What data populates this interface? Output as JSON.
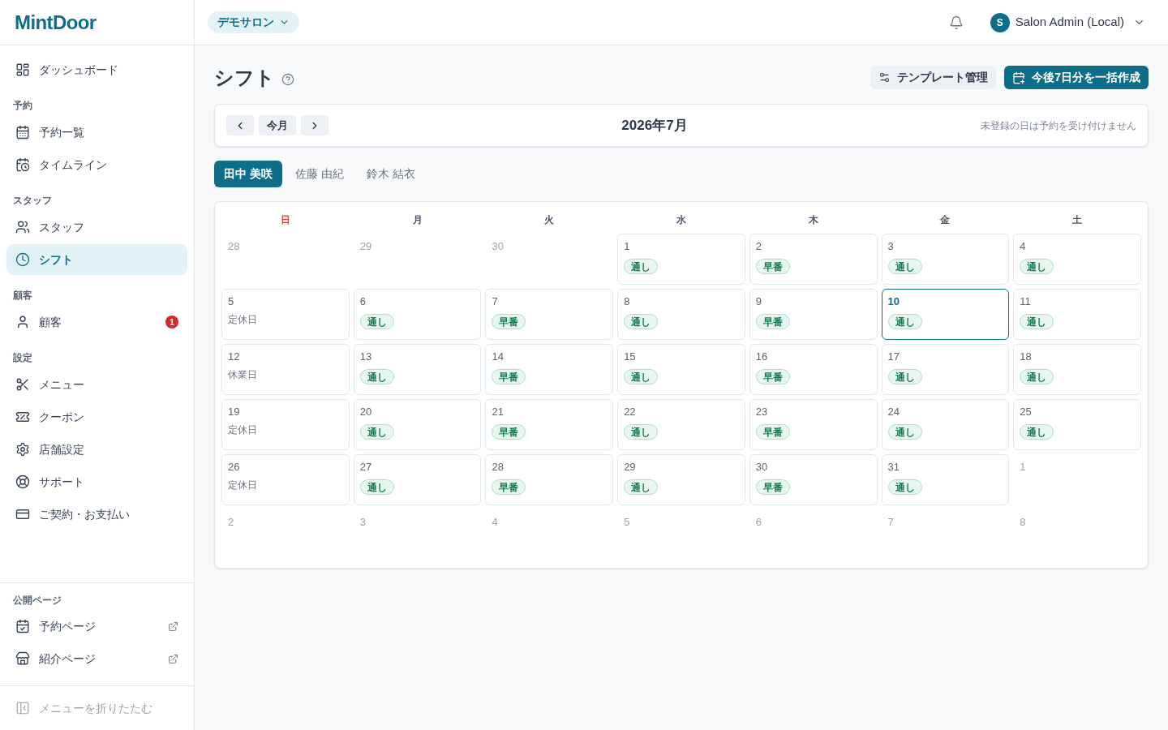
{
  "sidebar": {
    "logo": "MintDoor",
    "groups": [
      {
        "items": [
          {
            "label": "ダッシュボード",
            "selected": false
          }
        ]
      },
      {
        "heading": "予約",
        "items": [
          {
            "label": "予約一覧",
            "selected": false
          },
          {
            "label": "タイムライン",
            "selected": false
          }
        ]
      },
      {
        "heading": "スタッフ",
        "items": [
          {
            "label": "スタッフ",
            "selected": false
          },
          {
            "label": "シフト",
            "selected": true
          }
        ]
      },
      {
        "heading": "顧客",
        "items": [
          {
            "label": "顧客",
            "selected": false,
            "badge": "1"
          }
        ]
      },
      {
        "heading": "設定",
        "items": [
          {
            "label": "メニュー",
            "selected": false
          },
          {
            "label": "クーポン",
            "selected": false
          },
          {
            "label": "店舗設定",
            "selected": false
          },
          {
            "label": "サポート",
            "selected": false
          },
          {
            "label": "ご契約・お支払い",
            "selected": false
          }
        ]
      }
    ],
    "public": {
      "heading": "公開ページ",
      "items": [
        {
          "label": "予約ページ",
          "external": true
        },
        {
          "label": "紹介ページ",
          "external": true
        }
      ]
    },
    "collapse": "メニューを折りたたむ"
  },
  "header": {
    "salon": "デモサロン",
    "user": {
      "initial": "S",
      "name": "Salon Admin (Local)"
    }
  },
  "page": {
    "title": "シフト",
    "buttons": [
      {
        "label": "テンプレート管理",
        "kind": "secondary"
      },
      {
        "label": "今後7日分を一括作成",
        "kind": "primary"
      }
    ]
  },
  "month_nav": {
    "today": "今月",
    "title": "2026年7月",
    "note": "未登録の日は予約を受け付けません"
  },
  "staff_tabs": [
    {
      "label": "田中 美咲",
      "selected": true
    },
    {
      "label": "佐藤 由紀",
      "selected": false
    },
    {
      "label": "鈴木 結衣",
      "selected": false
    }
  ],
  "calendar": {
    "weekdays": [
      {
        "label": "日",
        "kind": "sunday"
      },
      {
        "label": "月",
        "kind": "weekday"
      },
      {
        "label": "火",
        "kind": "weekday"
      },
      {
        "label": "水",
        "kind": "weekday"
      },
      {
        "label": "木",
        "kind": "weekday"
      },
      {
        "label": "金",
        "kind": "weekday"
      },
      {
        "label": "土",
        "kind": "weekday"
      }
    ],
    "weeks": [
      [
        {
          "day": "28",
          "outside": true,
          "today": false
        },
        {
          "day": "29",
          "outside": true,
          "today": false
        },
        {
          "day": "30",
          "outside": true,
          "today": false
        },
        {
          "day": "1",
          "outside": false,
          "today": false,
          "shift": "通し"
        },
        {
          "day": "2",
          "outside": false,
          "today": false,
          "shift": "早番"
        },
        {
          "day": "3",
          "outside": false,
          "today": false,
          "shift": "通し"
        },
        {
          "day": "4",
          "outside": false,
          "today": false,
          "shift": "通し"
        }
      ],
      [
        {
          "day": "5",
          "outside": false,
          "today": false,
          "note": "定休日"
        },
        {
          "day": "6",
          "outside": false,
          "today": false,
          "shift": "通し"
        },
        {
          "day": "7",
          "outside": false,
          "today": false,
          "shift": "早番"
        },
        {
          "day": "8",
          "outside": false,
          "today": false,
          "shift": "通し"
        },
        {
          "day": "9",
          "outside": false,
          "today": false,
          "shift": "早番"
        },
        {
          "day": "10",
          "outside": false,
          "today": true,
          "shift": "通し"
        },
        {
          "day": "11",
          "outside": false,
          "today": false,
          "shift": "通し"
        }
      ],
      [
        {
          "day": "12",
          "outside": false,
          "today": false,
          "note": "休業日"
        },
        {
          "day": "13",
          "outside": false,
          "today": false,
          "shift": "通し"
        },
        {
          "day": "14",
          "outside": false,
          "today": false,
          "shift": "早番"
        },
        {
          "day": "15",
          "outside": false,
          "today": false,
          "shift": "通し"
        },
        {
          "day": "16",
          "outside": false,
          "today": false,
          "shift": "早番"
        },
        {
          "day": "17",
          "outside": false,
          "today": false,
          "shift": "通し"
        },
        {
          "day": "18",
          "outside": false,
          "today": false,
          "shift": "通し"
        }
      ],
      [
        {
          "day": "19",
          "outside": false,
          "today": false,
          "note": "定休日"
        },
        {
          "day": "20",
          "outside": false,
          "today": false,
          "shift": "通し"
        },
        {
          "day": "21",
          "outside": false,
          "today": false,
          "shift": "早番"
        },
        {
          "day": "22",
          "outside": false,
          "today": false,
          "shift": "通し"
        },
        {
          "day": "23",
          "outside": false,
          "today": false,
          "shift": "早番"
        },
        {
          "day": "24",
          "outside": false,
          "today": false,
          "shift": "通し"
        },
        {
          "day": "25",
          "outside": false,
          "today": false,
          "shift": "通し"
        }
      ],
      [
        {
          "day": "26",
          "outside": false,
          "today": false,
          "note": "定休日"
        },
        {
          "day": "27",
          "outside": false,
          "today": false,
          "shift": "通し"
        },
        {
          "day": "28",
          "outside": false,
          "today": false,
          "shift": "早番"
        },
        {
          "day": "29",
          "outside": false,
          "today": false,
          "shift": "通し"
        },
        {
          "day": "30",
          "outside": false,
          "today": false,
          "shift": "早番"
        },
        {
          "day": "31",
          "outside": false,
          "today": false,
          "shift": "通し"
        },
        {
          "day": "1",
          "outside": true,
          "today": false
        }
      ],
      [
        {
          "day": "2",
          "outside": true,
          "today": false
        },
        {
          "day": "3",
          "outside": true,
          "today": false
        },
        {
          "day": "4",
          "outside": true,
          "today": false
        },
        {
          "day": "5",
          "outside": true,
          "today": false
        },
        {
          "day": "6",
          "outside": true,
          "today": false
        },
        {
          "day": "7",
          "outside": true,
          "today": false
        },
        {
          "day": "8",
          "outside": true,
          "today": false
        }
      ]
    ]
  }
}
